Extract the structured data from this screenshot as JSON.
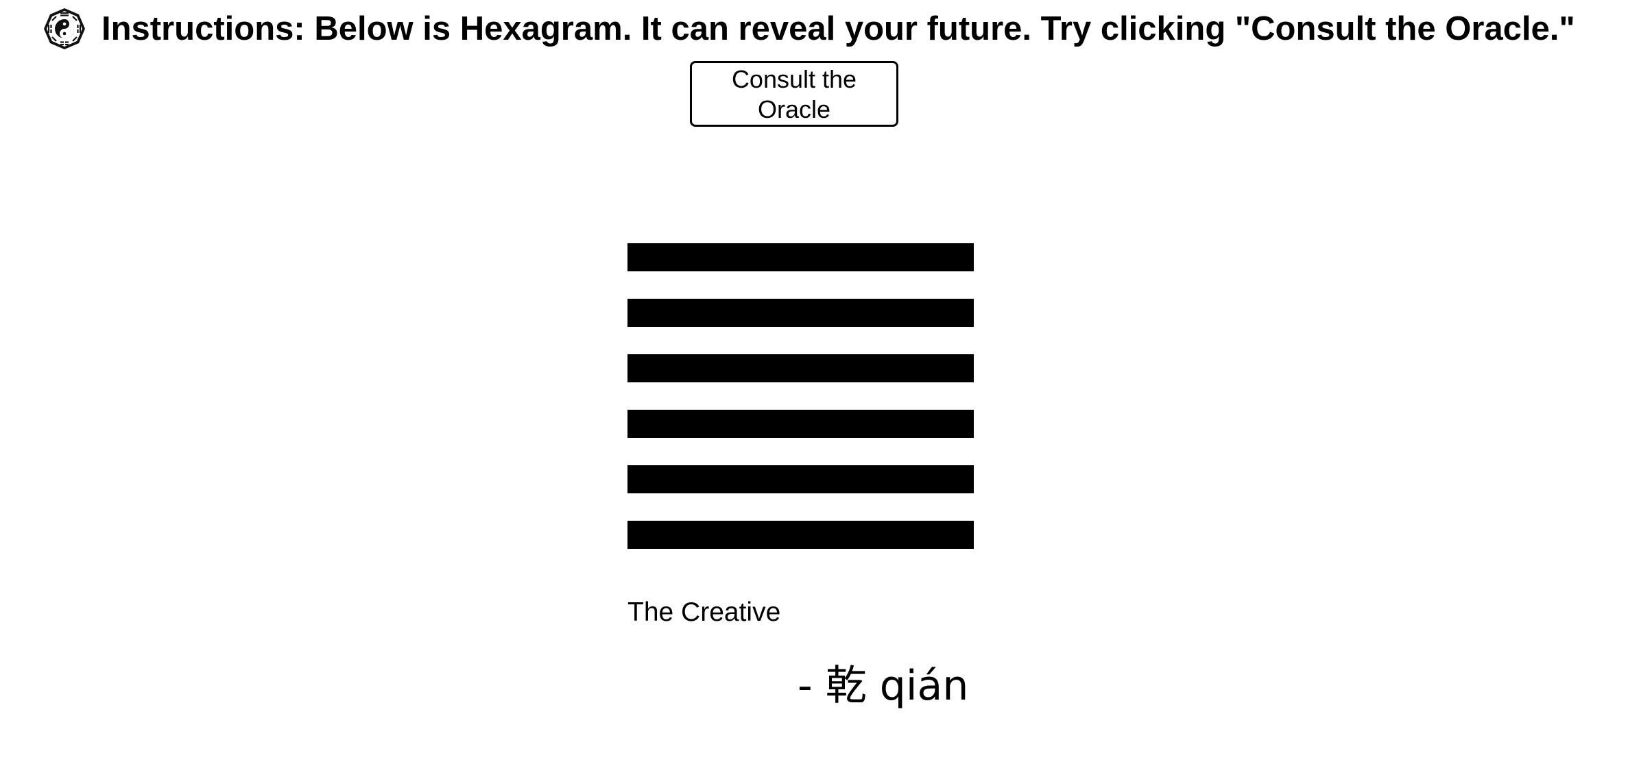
{
  "header": {
    "logo_icon": "yin-yang-bagua-icon",
    "instructions": "Instructions: Below is Hexagram. It can reveal your future. Try clicking \"Consult the Oracle.\""
  },
  "consult_button": {
    "label": "Consult the Oracle"
  },
  "hexagram": {
    "lines": [
      "solid",
      "solid",
      "solid",
      "solid",
      "solid",
      "solid"
    ],
    "name": "The Creative",
    "chinese": "- 乾 qián"
  }
}
